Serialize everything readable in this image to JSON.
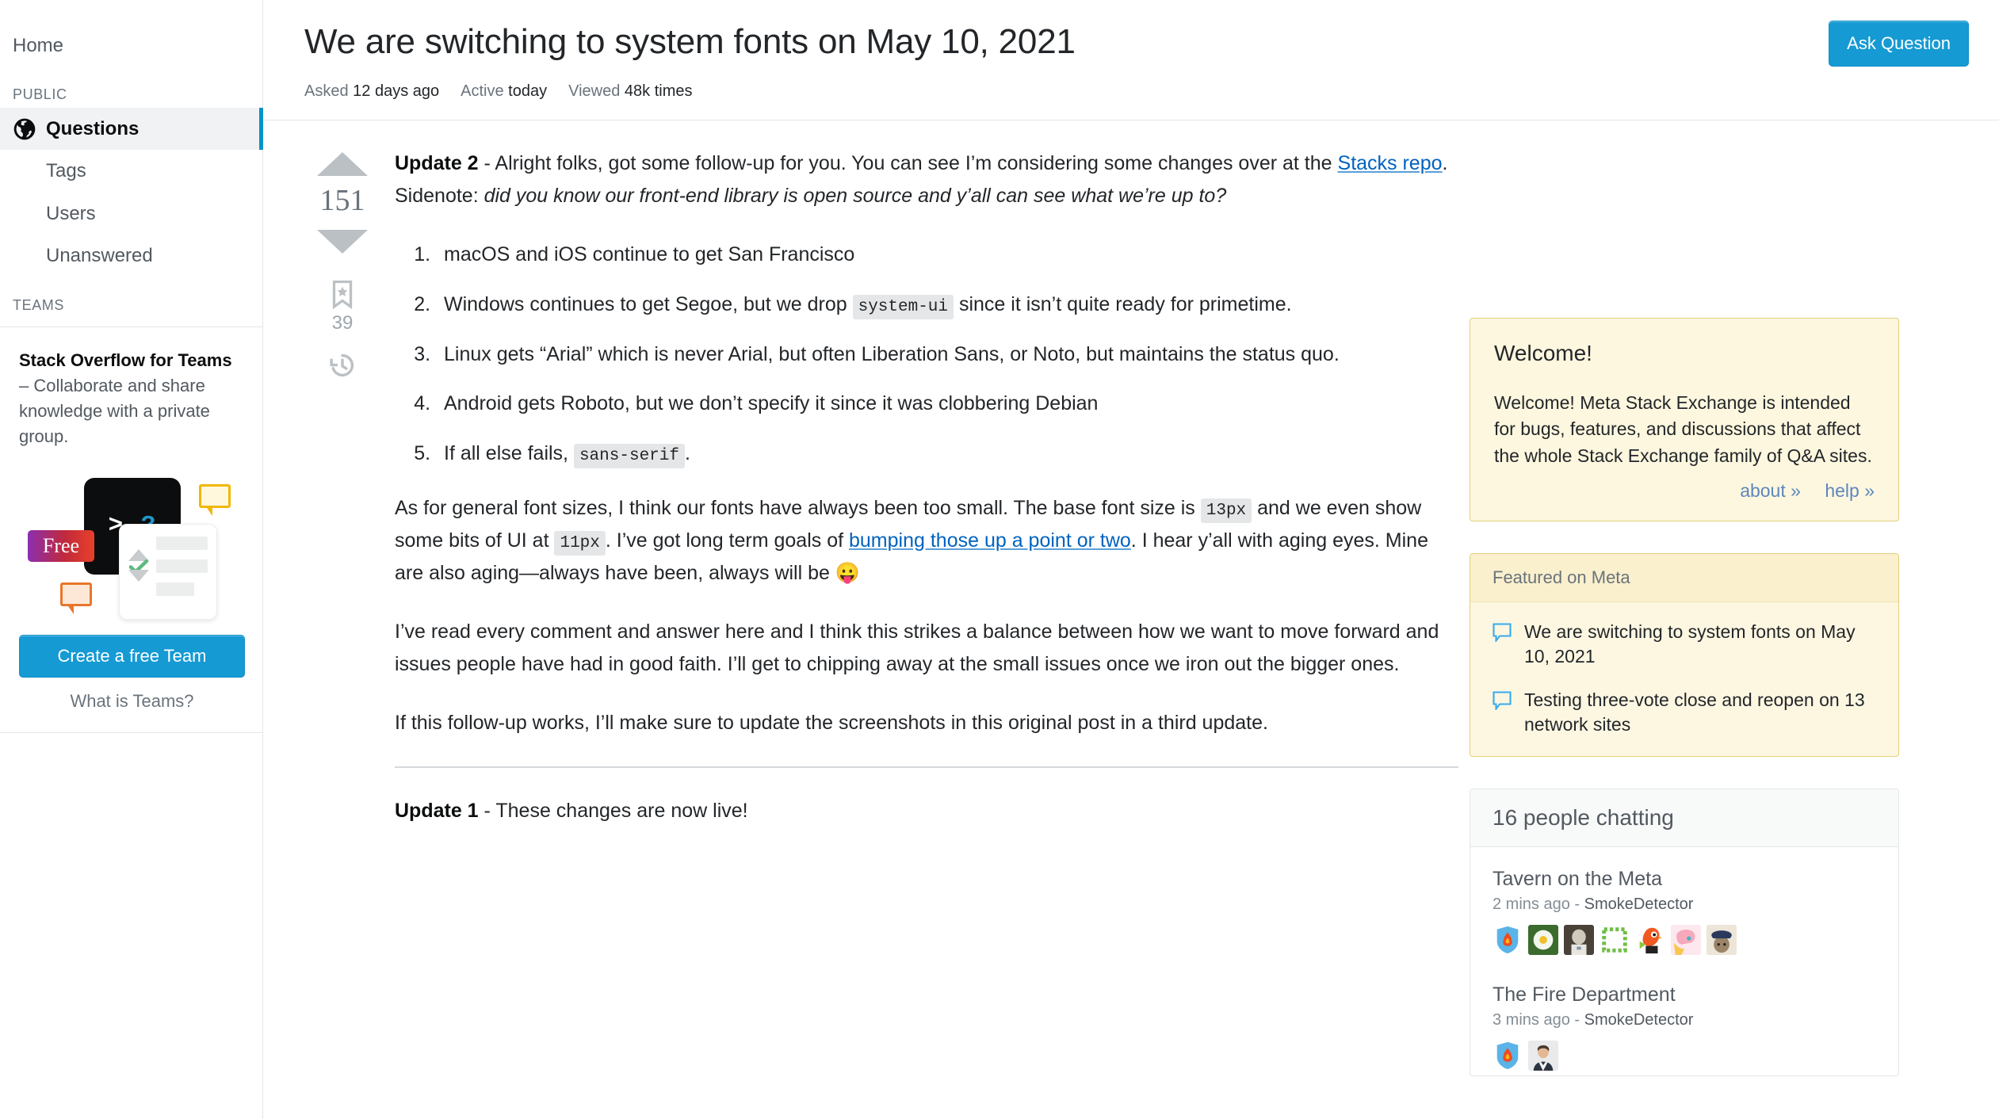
{
  "sidebar": {
    "home_label": "Home",
    "public_label": "PUBLIC",
    "teams_label": "TEAMS",
    "items": [
      {
        "label": "Questions",
        "icon": "globe-icon",
        "selected": true
      },
      {
        "label": "Tags",
        "icon": "",
        "selected": false
      },
      {
        "label": "Users",
        "icon": "",
        "selected": false
      },
      {
        "label": "Unanswered",
        "icon": "",
        "selected": false
      }
    ],
    "teams_promo": {
      "title": "Stack Overflow for Teams",
      "dash": " – ",
      "blurb": "Collaborate and share knowledge with a private group.",
      "art_prompt": ">_",
      "art_question": "?",
      "art_free_label": "Free",
      "cta_label": "Create a free Team",
      "what_is_label": "What is Teams?"
    }
  },
  "question": {
    "title": "We are switching to system fonts on May 10, 2021",
    "ask_button_label": "Ask Question",
    "meta": {
      "asked_label": "Asked",
      "asked_value": "12 days ago",
      "active_label": "Active",
      "active_value": "today",
      "viewed_label": "Viewed",
      "viewed_value": "48k times"
    },
    "votes": {
      "score": "151",
      "bookmark_count": "39",
      "upvote_icon": "arrow-up-icon",
      "downvote_icon": "arrow-down-icon",
      "bookmark_icon": "bookmark-star-icon",
      "history_icon": "clock-history-icon"
    },
    "post": {
      "update2_label": "Update 2",
      "update2_intro_a": " - Alright folks, got some follow-up for you. You can see I’m considering some changes over at the ",
      "update2_link": "Stacks repo",
      "update2_intro_b": ". Sidenote: ",
      "update2_italic": "did you know our front-end library is open source and y’all can see what we’re up to?",
      "list": [
        {
          "a": "macOS and iOS continue to get San Francisco",
          "code": "",
          "b": ""
        },
        {
          "a": "Windows continues to get Segoe, but we drop ",
          "code": "system-ui",
          "b": " since it isn’t quite ready for primetime."
        },
        {
          "a": "Linux gets “Arial” which is never Arial, but often Liberation Sans, or Noto, but maintains the status quo.",
          "code": "",
          "b": ""
        },
        {
          "a": "Android gets Roboto, but we don’t specify it since it was clobbering Debian",
          "code": "",
          "b": ""
        },
        {
          "a": "If all else fails, ",
          "code": "sans-serif",
          "b": "."
        }
      ],
      "p_sizes_a": "As for general font sizes, I think our fonts have always been too small. The base font size is ",
      "p_sizes_code1": "13px",
      "p_sizes_b": " and we even show some bits of UI at ",
      "p_sizes_code2": "11px",
      "p_sizes_c": ". I’ve got long term goals of ",
      "p_sizes_link": "bumping those up a point or two",
      "p_sizes_d": ". I hear y’all with aging eyes. Mine are also aging—always have been, always will be ",
      "p_sizes_emoji": "😛",
      "p_read": "I’ve read every comment and answer here and I think this strikes a balance between how we want to move forward and issues people have had in good faith. I’ll get to chipping away at the small issues once we iron out the bigger ones.",
      "p_follow": "If this follow-up works, I’ll make sure to update the screenshots in this original post in a third update.",
      "update1_label": "Update 1",
      "update1_text": " - These changes are now live!"
    }
  },
  "rail": {
    "welcome": {
      "heading": "Welcome!",
      "body": "Welcome! Meta Stack Exchange is intended for bugs, features, and discussions that affect the whole Stack Exchange family of Q&A sites.",
      "about_link": "about »",
      "help_link": "help »"
    },
    "featured": {
      "heading": "Featured on Meta",
      "items": [
        "We are switching to system fonts on May 10, 2021",
        "Testing three-vote close and reopen on 13 network sites"
      ]
    },
    "chat": {
      "heading": "16 people chatting",
      "rooms": [
        {
          "name": "Tavern on the Meta",
          "meta_time": "2 mins ago - ",
          "meta_user": "SmokeDetector",
          "avatar_count": 7
        },
        {
          "name": "The Fire Department",
          "meta_time": "3 mins ago - ",
          "meta_user": "SmokeDetector",
          "avatar_count": 2
        }
      ]
    }
  },
  "colors": {
    "accent_blue": "#159ad3",
    "selected_bar": "#0095c7",
    "link_blue": "#0063bf",
    "welcome_bg": "#fdf7df",
    "welcome_border": "#e3cf7a"
  }
}
